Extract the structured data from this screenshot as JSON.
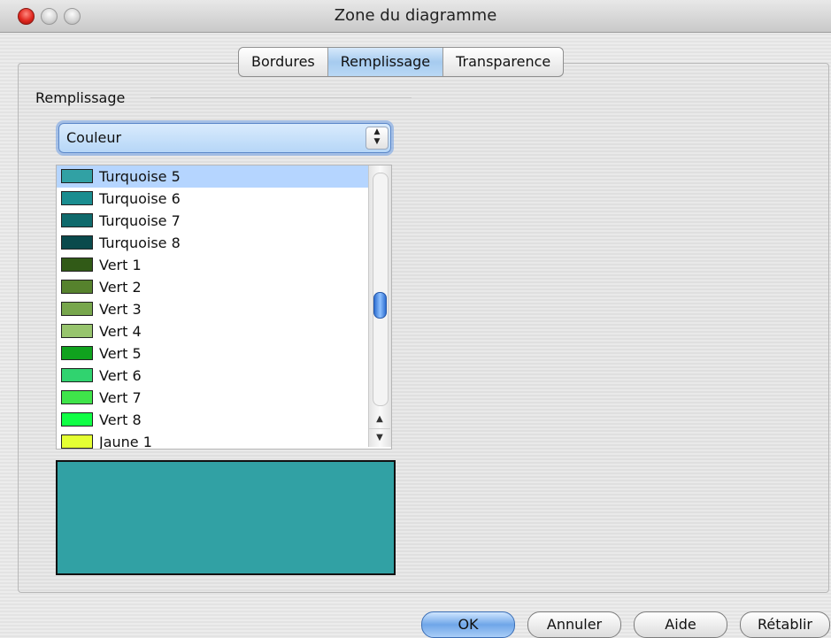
{
  "window": {
    "title": "Zone du diagramme"
  },
  "tabs": [
    {
      "label": "Bordures",
      "active": false
    },
    {
      "label": "Remplissage",
      "active": true
    },
    {
      "label": "Transparence",
      "active": false
    }
  ],
  "fill": {
    "group_label": "Remplissage",
    "type_select_value": "Couleur",
    "colors": [
      {
        "label": "Turquoise 5",
        "color": "#31a1a4",
        "selected": true
      },
      {
        "label": "Turquoise 6",
        "color": "#1a8d90",
        "selected": false
      },
      {
        "label": "Turquoise 7",
        "color": "#0f6a6c",
        "selected": false
      },
      {
        "label": "Turquoise 8",
        "color": "#0a4a4c",
        "selected": false
      },
      {
        "label": "Vert 1",
        "color": "#315a17",
        "selected": false
      },
      {
        "label": "Vert 2",
        "color": "#56822d",
        "selected": false
      },
      {
        "label": "Vert 3",
        "color": "#77a64c",
        "selected": false
      },
      {
        "label": "Vert 4",
        "color": "#97c46d",
        "selected": false
      },
      {
        "label": "Vert 5",
        "color": "#10a21e",
        "selected": false
      },
      {
        "label": "Vert 6",
        "color": "#30d36f",
        "selected": false
      },
      {
        "label": "Vert 7",
        "color": "#3fe44a",
        "selected": false
      },
      {
        "label": "Vert 8",
        "color": "#10ff45",
        "selected": false
      },
      {
        "label": "Jaune 1",
        "color": "#e4ff33",
        "selected": false
      }
    ],
    "preview_color": "#31a1a4",
    "scroll_position": 0.5
  },
  "buttons": {
    "ok": "OK",
    "cancel": "Annuler",
    "help": "Aide",
    "reset": "Rétablir"
  }
}
